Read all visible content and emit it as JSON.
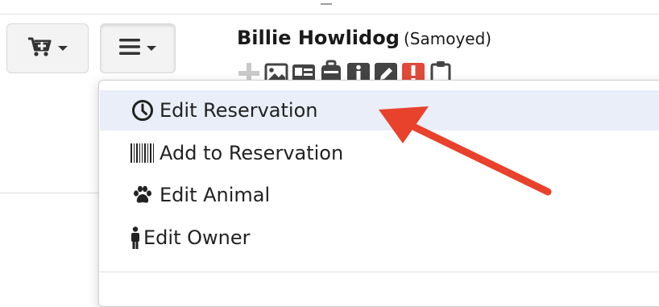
{
  "animal": {
    "name": "Billie Howlidog",
    "breed": "(Samoyed)"
  },
  "toolbar": {
    "cart_icon": "cart-plus-icon",
    "menu_icon": "hamburger-icon",
    "quick_icons": [
      "plus-icon",
      "image-icon",
      "id-card-icon",
      "suitcase-icon",
      "info-icon",
      "pencil-icon",
      "alert-icon",
      "clipboard-icon"
    ]
  },
  "menu": {
    "items": [
      {
        "label": "Edit Reservation",
        "icon": "clock-icon",
        "active": true
      },
      {
        "label": "Add to Reservation",
        "icon": "barcode-icon",
        "active": false
      },
      {
        "label": "Edit Animal",
        "icon": "paw-icon",
        "active": false
      },
      {
        "label": "Edit Owner",
        "icon": "person-icon",
        "active": false
      }
    ]
  },
  "colors": {
    "highlight": "#e9eef8",
    "annotation_arrow": "#e8412c",
    "alert_badge": "#e04a3a"
  }
}
